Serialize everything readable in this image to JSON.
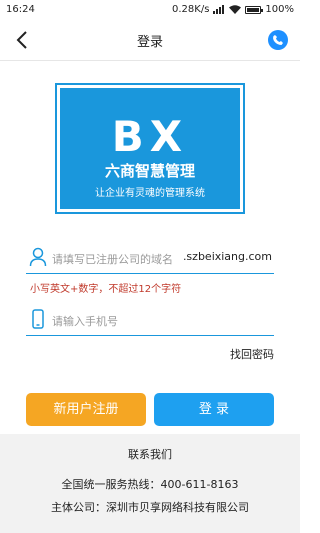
{
  "status_bar": {
    "time": "16:24",
    "speed": "0.28K/s",
    "battery": "100%",
    "battery_level": 1.0
  },
  "nav": {
    "title": "登录"
  },
  "logo": {
    "mark": "BX",
    "name": "六商智慧管理",
    "slogan": "让企业有灵魂的管理系统",
    "color": "#1a97dc"
  },
  "form": {
    "domain_placeholder": "请填写已注册公司的域名",
    "domain_suffix": ".szbeixiang.com",
    "domain_hint": "小写英文+数字，不超过12个字符",
    "phone_placeholder": "请输入手机号",
    "forgot_password": "找回密码"
  },
  "buttons": {
    "register": "新用户注册",
    "login": "登 录",
    "register_color": "#f5a623",
    "login_color": "#1ea0f0"
  },
  "footer": {
    "contact_title": "联系我们",
    "hotline": "全国统一服务热线：400-611-8163",
    "company": "主体公司：深圳市贝享网络科技有限公司"
  },
  "icons": [
    "back-arrow-icon",
    "phone-call-icon",
    "user-icon",
    "mobile-phone-icon",
    "wifi-icon",
    "signal-icon",
    "battery-icon"
  ]
}
